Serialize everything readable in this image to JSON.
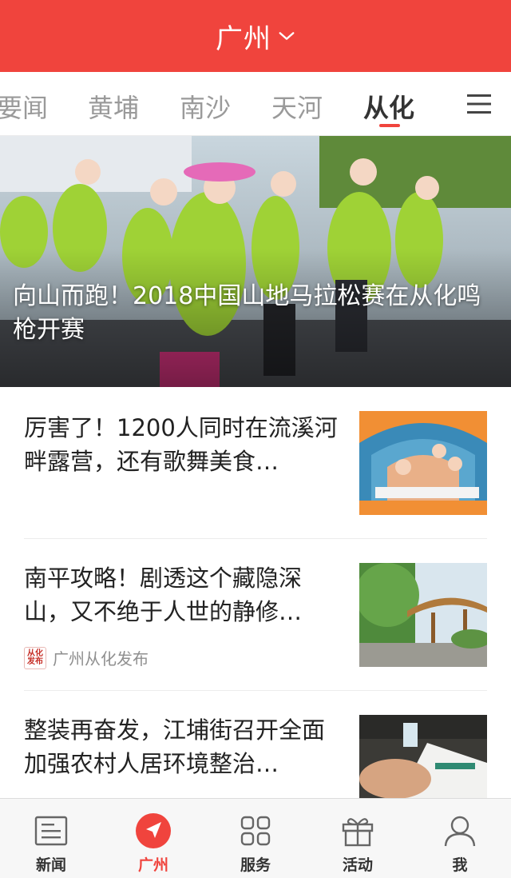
{
  "header": {
    "city": "广州"
  },
  "tabs": [
    {
      "label": "要闻"
    },
    {
      "label": "黄埔"
    },
    {
      "label": "南沙"
    },
    {
      "label": "天河"
    },
    {
      "label": "从化"
    }
  ],
  "hero": {
    "title": "向山而跑！2018中国山地马拉松赛在从化鸣枪开赛"
  },
  "articles": [
    {
      "title": "厉害了！1200人同时在流溪河畔露营，还有歌舞美食…"
    },
    {
      "title": "南平攻略！剧透这个藏隐深山，又不绝于人世的静修…",
      "source": "广州从化发布"
    },
    {
      "title": "整装再奋发，江埔街召开全面加强农村人居环境整治…"
    }
  ],
  "bottom_nav": [
    {
      "label": "新闻",
      "icon": "news-icon"
    },
    {
      "label": "广州",
      "icon": "navigate-icon"
    },
    {
      "label": "服务",
      "icon": "grid-icon"
    },
    {
      "label": "活动",
      "icon": "gift-icon"
    },
    {
      "label": "我",
      "icon": "user-icon"
    }
  ],
  "colors": {
    "accent": "#f0443d",
    "header_bg": "#f0443d",
    "text": "#222222",
    "muted": "#9a9a9a"
  }
}
